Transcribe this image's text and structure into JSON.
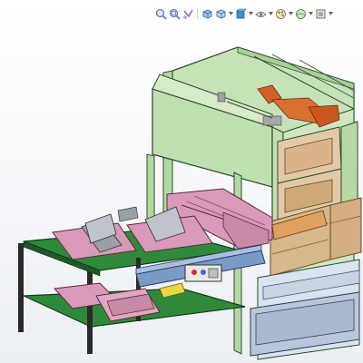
{
  "viewport": {
    "background": "#ffffff"
  },
  "heads_up_toolbar": {
    "tools": [
      {
        "name": "zoom-to-fit-icon",
        "color": "#5b7fb8"
      },
      {
        "name": "zoom-to-area-icon",
        "color": "#5b7fb8"
      },
      {
        "name": "previous-view-icon",
        "color": "#7a6ab0"
      },
      {
        "name": "section-view-icon",
        "color": "#4d8fc8"
      },
      {
        "name": "view-orientation-icon",
        "color": "#4d8fc8"
      },
      {
        "name": "display-style-icon",
        "color": "#3c8fd0"
      },
      {
        "name": "hide-show-items-icon",
        "color": "#8a8a8a"
      },
      {
        "name": "edit-appearance-icon",
        "color": "#d0503c"
      },
      {
        "name": "apply-scene-icon",
        "color": "#6a9a4a"
      },
      {
        "name": "view-settings-icon",
        "color": "#8a8a8a"
      }
    ]
  },
  "model": {
    "name": "packaging-machine-assembly",
    "colors": {
      "frame_green": "#bfe0b0",
      "frame_edge": "#2f4a2a",
      "base_green": "#2e8a3a",
      "pink_fixture": "#d89ab8",
      "robot_orange": "#d0602a",
      "glass_tan": "#d8b488",
      "steel_gray": "#9aa0a8",
      "conveyor_blue": "#7a9ac8"
    }
  }
}
